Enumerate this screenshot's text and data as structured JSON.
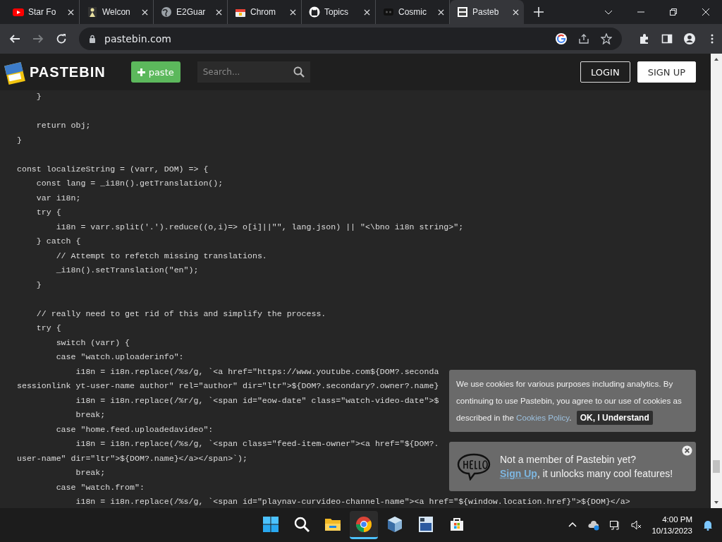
{
  "tabs": [
    {
      "title": "Star Fo",
      "selected": false
    },
    {
      "title": "Welcon",
      "selected": false
    },
    {
      "title": "E2Guar",
      "selected": false
    },
    {
      "title": "Chrom",
      "selected": false
    },
    {
      "title": "Topics",
      "selected": false
    },
    {
      "title": "Cosmic",
      "selected": false
    },
    {
      "title": "Pasteb",
      "selected": true
    }
  ],
  "address_bar": {
    "url": "pastebin.com"
  },
  "site_header": {
    "logo": "PASTEBIN",
    "paste_button": "paste",
    "search": {
      "placeholder": "Search..."
    },
    "login": "LOGIN",
    "signup": "SIGN UP"
  },
  "code_blocks": [
    [
      "    }"
    ],
    [
      "    return obj;",
      "}"
    ],
    [
      "const localizeString = (varr, DOM) => {",
      "    const lang = _i18n().getTranslation();",
      "    var i18n;",
      "    try {",
      "        i18n = varr.split('.').reduce((o,i)=> o[i]||\"\", lang.json) || \"<\\bno i18n string>\";",
      "    } catch {",
      "        // Attempt to refetch missing translations.",
      "        _i18n().setTranslation(\"en\");",
      "    }"
    ],
    [
      "    // really need to get rid of this and simplify the process.",
      "    try {",
      "        switch (varr) {",
      "        case \"watch.uploaderinfo\":",
      "            i18n = i18n.replace(/%s/g, `<a href=\"https://www.youtube.com${DOM?.seconda",
      "sessionlink yt-user-name author\" rel=\"author\" dir=\"ltr\">${DOM?.secondary?.owner?.name}",
      "            i18n = i18n.replace(/%r/g, `<span id=\"eow-date\" class=\"watch-video-date\">$",
      "            break;",
      "        case \"home.feed.uploadedavideo\":",
      "            i18n = i18n.replace(/%s/g, `<span class=\"feed-item-owner\"><a href=\"${DOM?.",
      "user-name\" dir=\"ltr\">${DOM?.name}</a></span>`);",
      "            break;",
      "        case \"watch.from\":",
      "            i18n = i18n.replace(/%s/g, `<span id=\"playnav-curvideo-channel-name\"><a href=\"${window.location.href}\">${DOM}</a>"
    ]
  ],
  "cookie_notice": {
    "text_before": "We use cookies for various purposes including analytics. By continuing to use Pastebin, you agree to our use of cookies as described in the ",
    "link": "Cookies Policy",
    "text_after": ".",
    "button": "OK, I Understand"
  },
  "signup_notice": {
    "title": "Not a member of Pastebin yet?",
    "link": "Sign Up",
    "text_after": ", it unlocks many cool features!"
  },
  "taskbar": {
    "apps": [
      {
        "selected": false
      },
      {
        "selected": false
      },
      {
        "selected": false
      },
      {
        "selected": true
      },
      {
        "selected": false
      },
      {
        "selected": false
      },
      {
        "selected": false
      }
    ],
    "time": "4:00 PM",
    "date": "10/13/2023"
  }
}
